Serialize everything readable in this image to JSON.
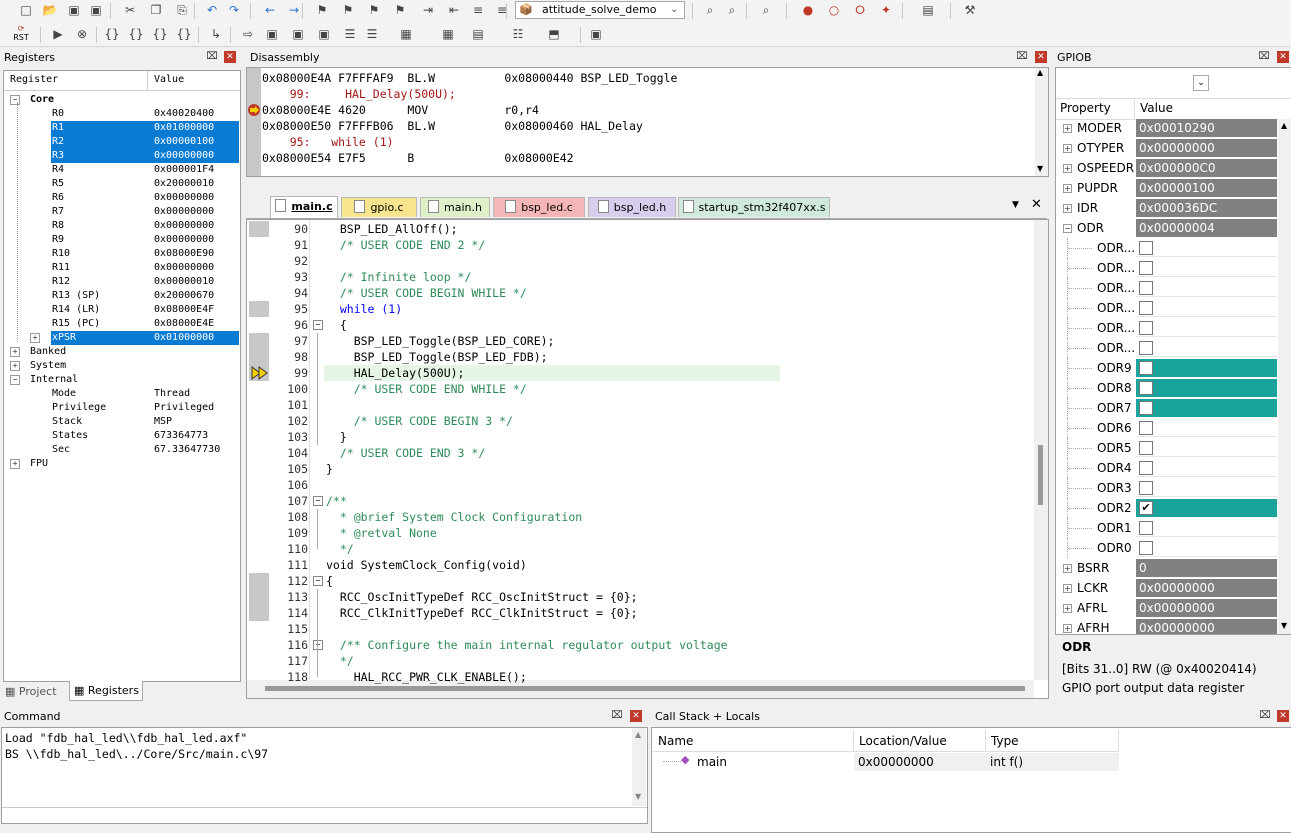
{
  "toolbar": {
    "project_combo": "attitude_solve_demo",
    "row1_icons": [
      "new-file-icon",
      "open-folder-icon",
      "save-icon",
      "save-all-icon",
      "cut-icon",
      "copy-icon",
      "paste-icon",
      "undo-icon",
      "redo-icon",
      "nav-back-icon",
      "nav-forward-icon",
      "bookmark-icon",
      "bookmark-prev-icon",
      "bookmark-next-icon",
      "bookmark-clear-icon",
      "indent-icon",
      "unindent-icon",
      "comment-icon",
      "uncomment-icon",
      "find-in-files-icon",
      "find-icon",
      "debug-icon",
      "breakpoint-icon",
      "breakpoint-disable-icon",
      "breakpoint-kill-icon",
      "breakpoint-all-icon",
      "window-layout-icon",
      "settings-wrench-icon"
    ],
    "row2_icons": [
      "reset-icon",
      "run-icon",
      "stop-icon",
      "step-into-icon",
      "step-over-icon",
      "step-out-icon",
      "run-to-cursor-icon",
      "show-next-statement-icon",
      "command-window-icon",
      "disassembly-window-icon",
      "symbols-window-icon",
      "registers-window-icon",
      "call-stack-window-icon",
      "watch-window-icon",
      "memory-window-icon",
      "serial-window-icon",
      "analysis-window-icon",
      "trace-window-icon",
      "system-viewer-icon",
      "toolbox-icon"
    ],
    "reset_label": "RST"
  },
  "registers": {
    "title": "Registers",
    "col_register": "Register",
    "col_value": "Value",
    "groups": [
      "Core",
      "Banked",
      "System",
      "Internal",
      "FPU"
    ],
    "core_rows": [
      {
        "name": "R0",
        "value": "0x40020400",
        "selected": false
      },
      {
        "name": "R1",
        "value": "0x01000000",
        "selected": true
      },
      {
        "name": "R2",
        "value": "0x00000100",
        "selected": true
      },
      {
        "name": "R3",
        "value": "0x00000000",
        "selected": true
      },
      {
        "name": "R4",
        "value": "0x000001F4",
        "selected": false
      },
      {
        "name": "R5",
        "value": "0x20000010",
        "selected": false
      },
      {
        "name": "R6",
        "value": "0x00000000",
        "selected": false
      },
      {
        "name": "R7",
        "value": "0x00000000",
        "selected": false
      },
      {
        "name": "R8",
        "value": "0x00000000",
        "selected": false
      },
      {
        "name": "R9",
        "value": "0x00000000",
        "selected": false
      },
      {
        "name": "R10",
        "value": "0x08000E90",
        "selected": false
      },
      {
        "name": "R11",
        "value": "0x00000000",
        "selected": false
      },
      {
        "name": "R12",
        "value": "0x00000010",
        "selected": false
      },
      {
        "name": "R13 (SP)",
        "value": "0x20000670",
        "selected": false
      },
      {
        "name": "R14 (LR)",
        "value": "0x08000E4F",
        "selected": false
      },
      {
        "name": "R15 (PC)",
        "value": "0x08000E4E",
        "selected": false
      },
      {
        "name": "xPSR",
        "value": "0x01000000",
        "selected": true
      }
    ],
    "internal_rows": [
      {
        "name": "Mode",
        "value": "Thread"
      },
      {
        "name": "Privilege",
        "value": "Privileged"
      },
      {
        "name": "Stack",
        "value": "MSP"
      },
      {
        "name": "States",
        "value": "673364773"
      },
      {
        "name": "Sec",
        "value": "67.33647730"
      }
    ],
    "tab_project": "Project",
    "tab_registers": "Registers"
  },
  "disassembly": {
    "title": "Disassembly",
    "lines": [
      {
        "text": "0x08000E4A F7FFFAF9  BL.W          0x08000440 BSP_LED_Toggle",
        "kind": "asm"
      },
      {
        "text": "    99:     HAL_Delay(500U);",
        "kind": "src"
      },
      {
        "text": "0x08000E4E 4620      MOV           r0,r4",
        "kind": "asm"
      },
      {
        "text": "0x08000E50 F7FFFB06  BL.W          0x08000460 HAL_Delay",
        "kind": "asm"
      },
      {
        "text": "    95:   while (1)",
        "kind": "src"
      },
      {
        "text": "0x08000E54 E7F5      B             0x08000E42",
        "kind": "asm"
      }
    ]
  },
  "editor": {
    "tabs": [
      {
        "label": "main.c",
        "color": "#dce6f4",
        "active": true
      },
      {
        "label": "gpio.c",
        "color": "#f6e58d"
      },
      {
        "label": "main.h",
        "color": "#dff0c8"
      },
      {
        "label": "bsp_led.c",
        "color": "#f4b6b6"
      },
      {
        "label": "bsp_led.h",
        "color": "#d9cdee"
      },
      {
        "label": "startup_stm32f407xx.s",
        "color": "#cfe9dc"
      }
    ],
    "lines": [
      {
        "n": "90",
        "t": "  BSP_LED_AllOff();",
        "c": "",
        "g": true
      },
      {
        "n": "91",
        "t": "  /* USER CODE END 2 */",
        "c": "cmt",
        "g": false
      },
      {
        "n": "92",
        "t": "",
        "c": "",
        "g": false
      },
      {
        "n": "93",
        "t": "  /* Infinite loop */",
        "c": "cmt",
        "g": false
      },
      {
        "n": "94",
        "t": "  /* USER CODE BEGIN WHILE */",
        "c": "cmt",
        "g": false
      },
      {
        "n": "95",
        "t": "  while (1)",
        "c": "kw",
        "g": true
      },
      {
        "n": "96",
        "t": "  {",
        "c": "",
        "g": false,
        "fold": true
      },
      {
        "n": "97",
        "t": "    BSP_LED_Toggle(BSP_LED_CORE);",
        "c": "",
        "g": true
      },
      {
        "n": "98",
        "t": "    BSP_LED_Toggle(BSP_LED_FDB);",
        "c": "",
        "g": true
      },
      {
        "n": "99",
        "t": "    HAL_Delay(500U);",
        "c": "",
        "g": true,
        "current": true
      },
      {
        "n": "100",
        "t": "    /* USER CODE END WHILE */",
        "c": "cmt",
        "g": false
      },
      {
        "n": "101",
        "t": "",
        "c": "",
        "g": false
      },
      {
        "n": "102",
        "t": "    /* USER CODE BEGIN 3 */",
        "c": "cmt",
        "g": false
      },
      {
        "n": "103",
        "t": "  }",
        "c": "",
        "g": false
      },
      {
        "n": "104",
        "t": "  /* USER CODE END 3 */",
        "c": "cmt",
        "g": false
      },
      {
        "n": "105",
        "t": "}",
        "c": "",
        "g": false
      },
      {
        "n": "106",
        "t": "",
        "c": "",
        "g": false
      },
      {
        "n": "107",
        "t": "/**",
        "c": "cmt",
        "g": false,
        "fold": true
      },
      {
        "n": "108",
        "t": "  * @brief System Clock Configuration",
        "c": "cmt",
        "g": false
      },
      {
        "n": "109",
        "t": "  * @retval None",
        "c": "cmt",
        "g": false
      },
      {
        "n": "110",
        "t": "  */",
        "c": "cmt",
        "g": false
      },
      {
        "n": "111",
        "t": "void SystemClock_Config(void)",
        "c": "",
        "g": false
      },
      {
        "n": "112",
        "t": "{",
        "c": "",
        "g": true,
        "fold": true
      },
      {
        "n": "113",
        "t": "  RCC_OscInitTypeDef RCC_OscInitStruct = {0};",
        "c": "",
        "g": true
      },
      {
        "n": "114",
        "t": "  RCC_ClkInitTypeDef RCC_ClkInitStruct = {0};",
        "c": "",
        "g": true
      },
      {
        "n": "115",
        "t": "",
        "c": "",
        "g": false
      },
      {
        "n": "116",
        "t": "  /** Configure the main internal regulator output voltage",
        "c": "cmt",
        "g": false,
        "fold": true
      },
      {
        "n": "117",
        "t": "  */",
        "c": "cmt",
        "g": false
      },
      {
        "n": "118",
        "t": "    HAL_RCC_PWR_CLK_ENABLE();",
        "c": "",
        "g": false
      }
    ]
  },
  "gpio": {
    "title": "GPIOB",
    "col_property": "Property",
    "col_value": "Value",
    "rows": [
      {
        "name": "MODER",
        "value": "0x00010290",
        "kind": "reg"
      },
      {
        "name": "OTYPER",
        "value": "0x00000000",
        "kind": "reg"
      },
      {
        "name": "OSPEEDR",
        "value": "0x000000C0",
        "kind": "reg"
      },
      {
        "name": "PUPDR",
        "value": "0x00000100",
        "kind": "reg"
      },
      {
        "name": "IDR",
        "value": "0x000036DC",
        "kind": "reg"
      },
      {
        "name": "ODR",
        "value": "0x00000004",
        "kind": "reg",
        "expanded": true
      },
      {
        "name": "ODR...",
        "kind": "bit",
        "checked": false,
        "hl": false
      },
      {
        "name": "ODR...",
        "kind": "bit",
        "checked": false,
        "hl": false
      },
      {
        "name": "ODR...",
        "kind": "bit",
        "checked": false,
        "hl": false
      },
      {
        "name": "ODR...",
        "kind": "bit",
        "checked": false,
        "hl": false
      },
      {
        "name": "ODR...",
        "kind": "bit",
        "checked": false,
        "hl": false
      },
      {
        "name": "ODR...",
        "kind": "bit",
        "checked": false,
        "hl": false
      },
      {
        "name": "ODR9",
        "kind": "bit",
        "checked": false,
        "hl": true
      },
      {
        "name": "ODR8",
        "kind": "bit",
        "checked": false,
        "hl": true
      },
      {
        "name": "ODR7",
        "kind": "bit",
        "checked": false,
        "hl": true
      },
      {
        "name": "ODR6",
        "kind": "bit",
        "checked": false,
        "hl": false
      },
      {
        "name": "ODR5",
        "kind": "bit",
        "checked": false,
        "hl": false
      },
      {
        "name": "ODR4",
        "kind": "bit",
        "checked": false,
        "hl": false
      },
      {
        "name": "ODR3",
        "kind": "bit",
        "checked": false,
        "hl": false
      },
      {
        "name": "ODR2",
        "kind": "bit",
        "checked": true,
        "hl": true
      },
      {
        "name": "ODR1",
        "kind": "bit",
        "checked": false,
        "hl": false
      },
      {
        "name": "ODR0",
        "kind": "bit",
        "checked": false,
        "hl": false
      },
      {
        "name": "BSRR",
        "value": "0",
        "kind": "reg"
      },
      {
        "name": "LCKR",
        "value": "0x00000000",
        "kind": "reg"
      },
      {
        "name": "AFRL",
        "value": "0x00000000",
        "kind": "reg"
      },
      {
        "name": "AFRH",
        "value": "0x00000000",
        "kind": "reg"
      }
    ],
    "desc_title": "ODR",
    "desc_text": "[Bits 31..0] RW (@ 0x40020414) GPIO port output data register"
  },
  "command": {
    "title": "Command",
    "lines": [
      "Load \"fdb_hal_led\\\\fdb_hal_led.axf\"",
      "BS \\\\fdb_hal_led\\../Core/Src/main.c\\97"
    ]
  },
  "callstack": {
    "title": "Call Stack + Locals",
    "col_name": "Name",
    "col_location": "Location/Value",
    "col_type": "Type",
    "rows": [
      {
        "name": "main",
        "location": "0x00000000",
        "type": "int f()"
      }
    ]
  },
  "colors": {
    "selection": "#0a7bd3",
    "teal": "#1aa39a",
    "current_line": "#e6f5e6"
  }
}
